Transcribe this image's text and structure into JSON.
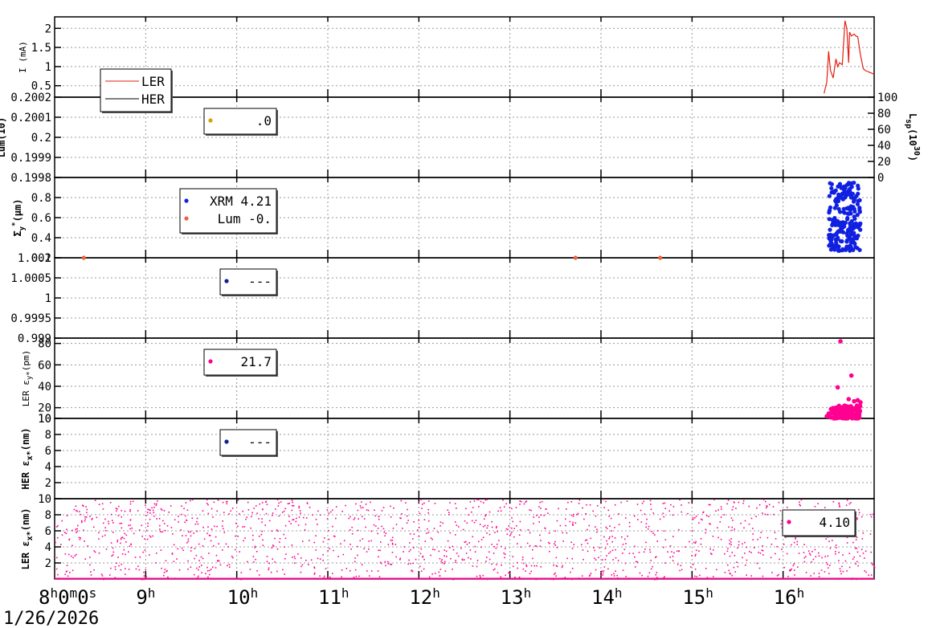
{
  "chart_data": [
    {
      "type": "line",
      "ylabel": "I (mA)",
      "ylim": [
        0.2,
        2.3
      ],
      "yticks": [
        "0.5",
        "1",
        "1.5",
        "2"
      ],
      "legend": {
        "placement": "bottom-left"
      },
      "series": [
        {
          "name": "LER",
          "color": "#e02010",
          "x": [
            16.45,
            16.48,
            16.5,
            16.52,
            16.55,
            16.58,
            16.6,
            16.62,
            16.65,
            16.68,
            16.7,
            16.72,
            16.73,
            16.75,
            16.78,
            16.8,
            16.82,
            16.85,
            16.88,
            16.9,
            16.92,
            16.95,
            17.0
          ],
          "y": [
            0.3,
            0.6,
            1.4,
            0.9,
            0.7,
            1.2,
            1.0,
            1.1,
            1.05,
            2.2,
            2.0,
            1.1,
            1.9,
            1.8,
            1.85,
            1.8,
            1.78,
            1.3,
            0.95,
            0.9,
            0.88,
            0.85,
            0.8
          ]
        },
        {
          "name": "HER",
          "color": "#000000",
          "x": [],
          "y": []
        }
      ]
    },
    {
      "type": "scatter",
      "ylabel": "Lum(10",
      "ylim": [
        0.1998,
        0.2002
      ],
      "yticks": [
        "0.1998",
        "0.1999",
        "0.2",
        "0.2001",
        "0.2002"
      ],
      "y2label": "L",
      "y2ticks": [
        "0",
        "20",
        "40",
        "60",
        "80",
        "100"
      ],
      "legend": {
        "placement": "top-left",
        "entries": [
          {
            "label": ".0",
            "color": "#d8a000"
          }
        ]
      },
      "series": []
    },
    {
      "type": "scatter",
      "ylabel": "Σ",
      "ylim": [
        0.2,
        1.0
      ],
      "yticks": [
        "0.2",
        "0.4",
        "0.6",
        "0.8"
      ],
      "legend": {
        "placement": "top-left",
        "entries": [
          {
            "label": "XRM 4.21",
            "color": "#1020e0"
          },
          {
            "label": "Lum -0.",
            "color": "#f06040"
          }
        ]
      },
      "series": [
        {
          "name": "XRM",
          "color": "#1020e0",
          "cluster": {
            "x_range": [
              16.5,
              16.85
            ],
            "y_range": [
              0.27,
              0.95
            ],
            "count": 220
          }
        },
        {
          "name": "Lum",
          "color": "#f06040",
          "x": [
            8.32,
            13.72,
            14.65
          ],
          "y": [
            0.2,
            0.2,
            0.2
          ]
        }
      ]
    },
    {
      "type": "scatter",
      "ylabel": "",
      "ylim": [
        0.999,
        1.001
      ],
      "yticks": [
        "0.999",
        "0.9995",
        "1",
        "1.0005",
        "1.001"
      ],
      "legend": {
        "placement": "top-left",
        "entries": [
          {
            "label": "---",
            "color": "#102090"
          }
        ]
      },
      "series": []
    },
    {
      "type": "scatter",
      "ylabel": "LER ε",
      "ylim": [
        10,
        85
      ],
      "yticks": [
        "10",
        "20",
        "40",
        "60",
        "80"
      ],
      "legend": {
        "placement": "top-left",
        "entries": [
          {
            "label": "21.7",
            "color": "#ff0090"
          }
        ]
      },
      "series": [
        {
          "name": "LER εy*",
          "color": "#ff0090",
          "x": [
            16.63,
            16.6,
            16.75,
            16.48,
            16.72,
            16.78,
            16.82,
            16.85
          ],
          "y": [
            82,
            39,
            50,
            12,
            28,
            26,
            27,
            25
          ],
          "cluster": {
            "x_range": [
              16.5,
              16.85
            ],
            "y_range": [
              10,
              22
            ],
            "count": 150
          }
        }
      ]
    },
    {
      "type": "scatter",
      "ylabel": "HER ε",
      "ylim": [
        0,
        10
      ],
      "yticks": [
        "2",
        "4",
        "6",
        "8",
        "10"
      ],
      "legend": {
        "placement": "top-left",
        "entries": [
          {
            "label": "---",
            "color": "#102090"
          }
        ]
      },
      "series": []
    },
    {
      "type": "scatter",
      "ylabel": "LER ε",
      "ylim": [
        0,
        10
      ],
      "yticks": [
        "2",
        "4",
        "6",
        "8",
        "10"
      ],
      "legend": {
        "placement": "top-right",
        "entries": [
          {
            "label": "4.10",
            "color": "#ff0090"
          }
        ]
      },
      "series": [
        {
          "name": "LER εx*",
          "color": "#ff0090",
          "cluster": {
            "x_range": [
              8.0,
              17.0
            ],
            "y_range": [
              0,
              10
            ],
            "count": 1500
          }
        },
        {
          "name": "LER εx* baseline",
          "color": "#ff0090",
          "x": [
            8.0,
            17.0
          ],
          "y": [
            0.05,
            0.05
          ]
        }
      ]
    }
  ],
  "x_axis": {
    "range": [
      8.0,
      17.0
    ],
    "tick_labels": [
      "8",
      "9",
      "10",
      "11",
      "12",
      "13",
      "14",
      "15",
      "16"
    ],
    "tick_superscript": "h",
    "first_suffix": [
      "0",
      "m",
      "0",
      "s"
    ],
    "date": "1/26/2026"
  },
  "units": {
    "current": "(mA)",
    "sigma_sub": "y",
    "sigma_sup": "*",
    "sigma_unit": "(μm)",
    "lum_exp": ")",
    "lsp_sub": "sp",
    "lsp_unit": "(10",
    "lsp_exp": "30",
    "lsp_close": ")",
    "eps_sub": "x*",
    "eps_ysub": "y*",
    "eps_nm": "(nm)",
    "eps_pm": "(pm)"
  }
}
